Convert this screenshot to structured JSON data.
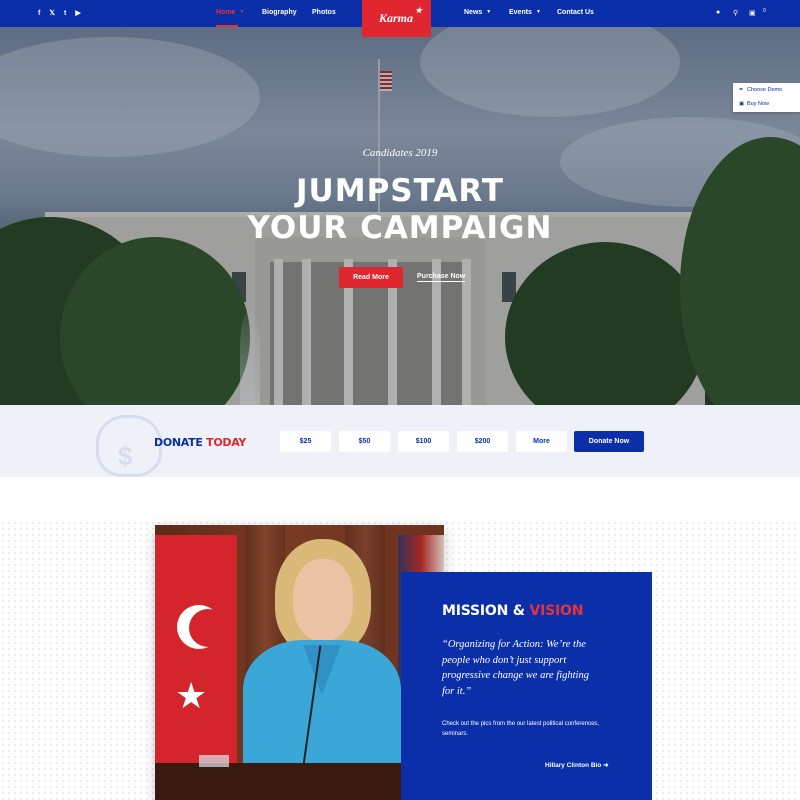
{
  "nav": {
    "social": [
      "f",
      "𝕏",
      "t",
      "▶"
    ],
    "items": [
      {
        "label": "Home",
        "active": true,
        "dropdown": true
      },
      {
        "label": "Biography",
        "active": false,
        "dropdown": false
      },
      {
        "label": "Photos",
        "active": false,
        "dropdown": false
      },
      {
        "label": "News",
        "active": false,
        "dropdown": true
      },
      {
        "label": "Events",
        "active": false,
        "dropdown": true
      },
      {
        "label": "Contact Us",
        "active": false,
        "dropdown": false
      }
    ],
    "logo": "Karma",
    "cart_count": "0"
  },
  "side_panel": {
    "choose_demo": "Choose Demo",
    "buy_now": "Buy Now"
  },
  "hero": {
    "subtitle": "Candidates 2019",
    "title_line1": "JUMPSTART",
    "title_line2": "YOUR CAMPAIGN",
    "read_more": "Read More",
    "purchase_now": "Purchase Now"
  },
  "donate": {
    "title_a": "DONATE",
    "title_b": "TODAY",
    "amounts": [
      "$25",
      "$50",
      "$100",
      "$200",
      "More"
    ],
    "donate_now": "Donate Now"
  },
  "mission": {
    "title_a": "MISSION &",
    "title_b": "VISION",
    "quote": "“Organizing for Action: We’re the people who don’t just support progressive change we are fighting for it.”",
    "description": "Check out the pics from the our latest political conferences, seminars.",
    "bio_link": "Hillary Clinton Bio"
  },
  "colors": {
    "brand_blue": "#0b2fa8",
    "brand_red": "#e0262f",
    "donate_bg": "#eef1f8"
  }
}
